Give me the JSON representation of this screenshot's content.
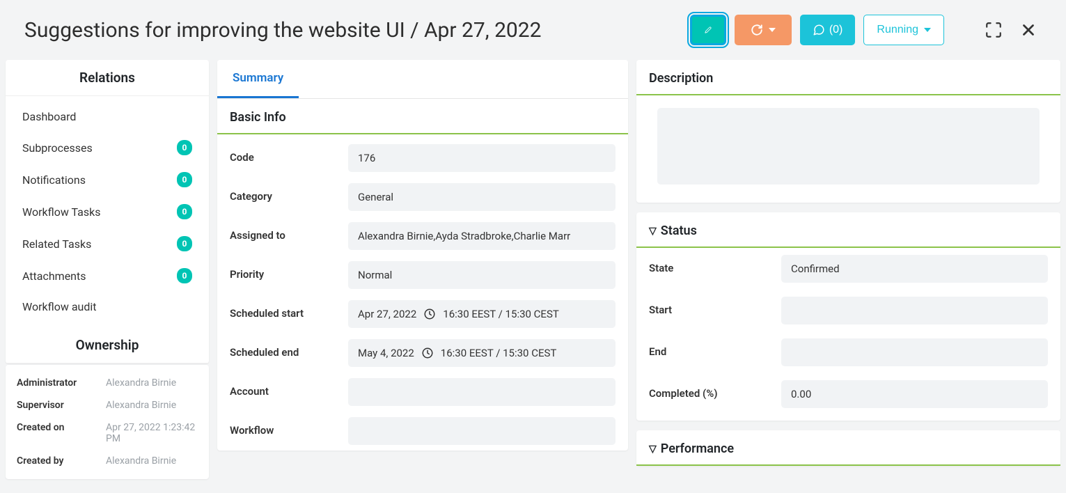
{
  "header": {
    "title": "Suggestions for improving the website UI / Apr 27, 2022",
    "comments_label": "(0)",
    "running_label": "Running"
  },
  "sidebar": {
    "relations_title": "Relations",
    "items": [
      {
        "label": "Dashboard",
        "badge": null
      },
      {
        "label": "Subprocesses",
        "badge": "0"
      },
      {
        "label": "Notifications",
        "badge": "0"
      },
      {
        "label": "Workflow Tasks",
        "badge": "0"
      },
      {
        "label": "Related Tasks",
        "badge": "0"
      },
      {
        "label": "Attachments",
        "badge": "0"
      },
      {
        "label": "Workflow audit",
        "badge": null
      }
    ],
    "ownership_title": "Ownership",
    "ownership": [
      {
        "label": "Administrator",
        "value": "Alexandra Birnie"
      },
      {
        "label": "Supervisor",
        "value": "Alexandra Birnie"
      },
      {
        "label": "Created on",
        "value": "Apr 27, 2022 1:23:42 PM"
      },
      {
        "label": "Created by",
        "value": "Alexandra Birnie"
      }
    ]
  },
  "tabs": {
    "summary": "Summary"
  },
  "basic_info": {
    "title": "Basic Info",
    "rows": {
      "code_label": "Code",
      "code_value": "176",
      "category_label": "Category",
      "category_value": "General",
      "assigned_label": "Assigned to",
      "assigned_value": "Alexandra Birnie,Ayda Stradbroke,Charlie Marr",
      "priority_label": "Priority",
      "priority_value": "Normal",
      "sstart_label": "Scheduled start",
      "sstart_date": "Apr 27, 2022",
      "sstart_time": "16:30 EEST / 15:30 CEST",
      "send_label": "Scheduled end",
      "send_date": "May 4, 2022",
      "send_time": "16:30 EEST / 15:30 CEST",
      "account_label": "Account",
      "account_value": "",
      "workflow_label": "Workflow",
      "workflow_value": ""
    }
  },
  "description": {
    "title": "Description",
    "value": ""
  },
  "status": {
    "title": "Status",
    "state_label": "State",
    "state_value": "Confirmed",
    "start_label": "Start",
    "start_value": "",
    "end_label": "End",
    "end_value": "",
    "completed_label": "Completed (%)",
    "completed_value": "0.00"
  },
  "performance": {
    "title": "Performance"
  }
}
